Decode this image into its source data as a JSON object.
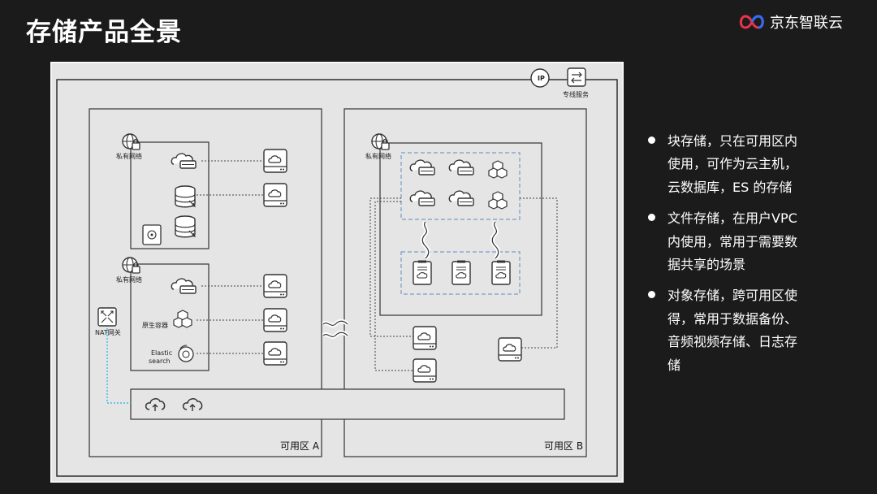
{
  "page": {
    "title": "存储产品全景",
    "brand": {
      "name": "京东智联云",
      "logo_icon": "jd-cloud-logo-icon"
    }
  },
  "diagram": {
    "top_labels": {
      "ip_icon_text": "IP",
      "dedicated_line": "专线服务"
    },
    "zone_a": {
      "label": "可用区 A",
      "vpc1_label": "私有网络",
      "vpc2_label": "私有网络",
      "nat_label": "NAT网关",
      "native_container_label": "原生容器",
      "elastic_label_line1": "Elastic",
      "elastic_label_line2": "search"
    },
    "zone_b": {
      "label": "可用区 B",
      "vpc_label": "私有网络"
    }
  },
  "bullets": [
    {
      "text": "块存储，只在可用区内使用，可作为云主机，云数据库，ES 的存储"
    },
    {
      "text": "文件存储，在用户VPC 内使用，常用于需要数据共享的场景"
    },
    {
      "text": "对象存储，跨可用区使得，常用于数据备份、音频视频存储、日志存储"
    }
  ]
}
